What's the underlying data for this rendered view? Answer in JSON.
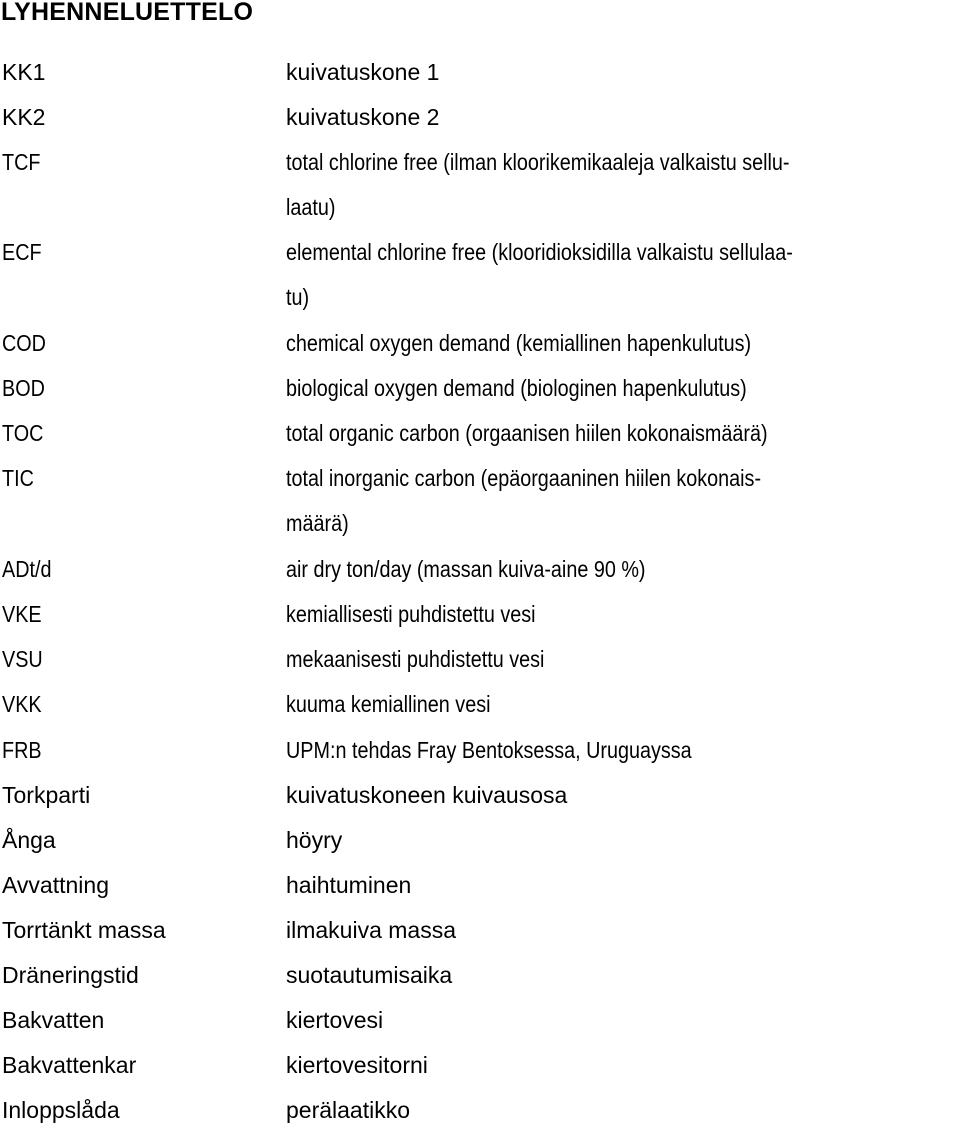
{
  "title": "LYHENNELUETTELO",
  "entries": [
    {
      "abbr": "KK1",
      "def": [
        "kuivatuskone 1"
      ]
    },
    {
      "abbr": "KK2",
      "def": [
        "kuivatuskone 2"
      ]
    },
    {
      "abbr": "TCF",
      "def": [
        "total chlorine free (ilman kloorikemikaaleja valkaistu sellu-",
        "laatu)"
      ]
    },
    {
      "abbr": "ECF",
      "def": [
        "elemental chlorine free (klooridioksidilla valkaistu sellulaa-",
        "tu)"
      ]
    },
    {
      "abbr": "COD",
      "def": [
        "chemical oxygen demand (kemiallinen hapenkulutus)"
      ]
    },
    {
      "abbr": "BOD",
      "def": [
        "biological oxygen demand (biologinen hapenkulutus)"
      ]
    },
    {
      "abbr": "TOC",
      "def": [
        "total organic carbon (orgaanisen hiilen kokonaismäärä)"
      ]
    },
    {
      "abbr": "TIC",
      "def": [
        "total inorganic carbon (epäorgaaninen hiilen kokonais-",
        "määrä)"
      ]
    },
    {
      "abbr": "ADt/d",
      "def": [
        "air dry ton/day (massan kuiva-aine 90 %)"
      ]
    },
    {
      "abbr": "VKE",
      "def": [
        "kemiallisesti puhdistettu vesi"
      ]
    },
    {
      "abbr": "VSU",
      "def": [
        "mekaanisesti puhdistettu vesi"
      ]
    },
    {
      "abbr": "VKK",
      "def": [
        "kuuma kemiallinen vesi"
      ]
    },
    {
      "abbr": "FRB",
      "def": [
        "UPM:n tehdas Fray Bentoksessa, Uruguayssa"
      ]
    },
    {
      "abbr": "Torkparti",
      "def": [
        "kuivatuskoneen kuivausosa"
      ]
    },
    {
      "abbr": "Ånga",
      "def": [
        "höyry"
      ]
    },
    {
      "abbr": "Avvattning",
      "def": [
        "haihtuminen"
      ]
    },
    {
      "abbr": "Torrtänkt massa",
      "def": [
        "ilmakuiva massa"
      ]
    },
    {
      "abbr": "Dräneringstid",
      "def": [
        "suotautumisaika"
      ]
    },
    {
      "abbr": "Bakvatten",
      "def": [
        "kiertovesi"
      ]
    },
    {
      "abbr": "Bakvattenkar",
      "def": [
        "kiertovesitorni"
      ]
    },
    {
      "abbr": "Inloppslåda",
      "def": [
        "perälaatikko"
      ]
    }
  ]
}
